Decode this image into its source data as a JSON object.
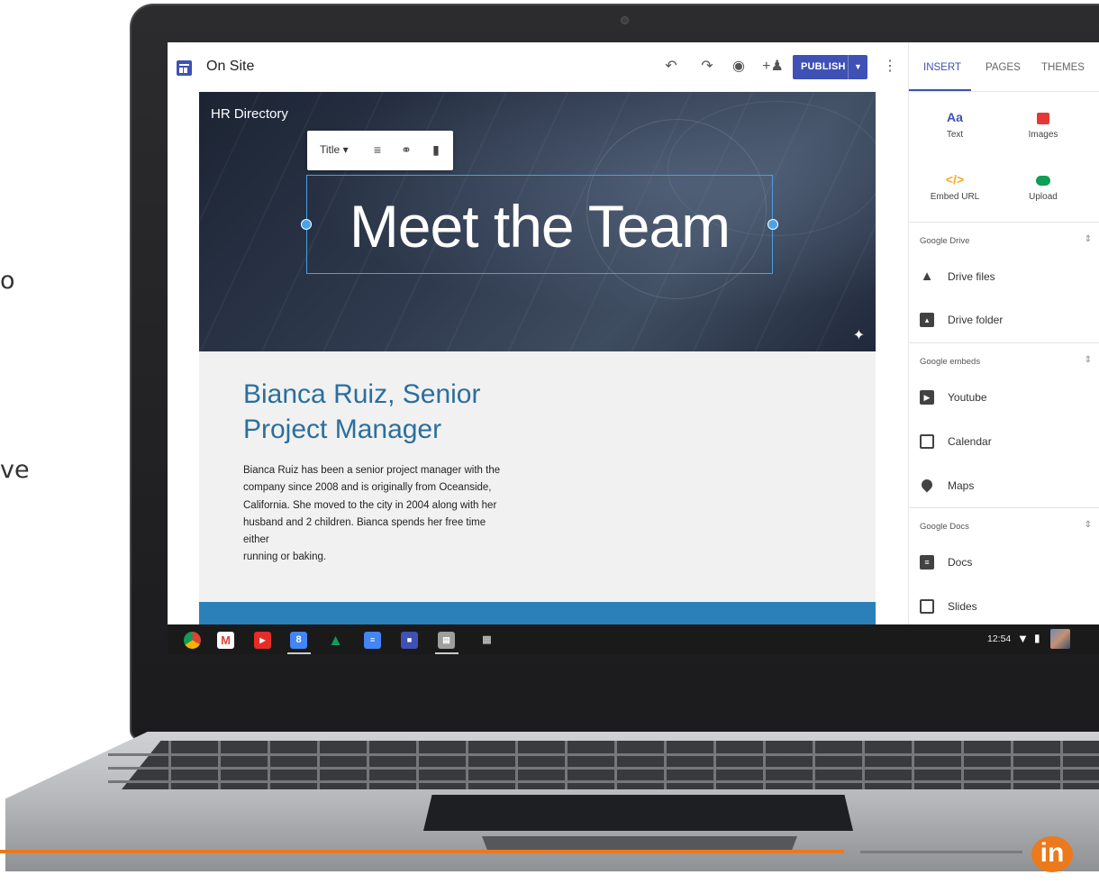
{
  "slide": {
    "left_text_top": "o",
    "left_text_bottom": "ve"
  },
  "app": {
    "title": "On Site",
    "publish_label": "PUBLISH"
  },
  "hero": {
    "page_name": "HR Directory",
    "title": "Meet the Team",
    "toolbar_style_label": "Title"
  },
  "content": {
    "name_line1": "Bianca Ruiz, Senior",
    "name_line2": "Project Manager",
    "bio": [
      "Bianca Ruiz has been a senior project manager with the",
      "company since 2008 and is originally from Oceanside,",
      "California.  She moved to the city in 2004 along with her",
      "husband and 2 children.  Bianca spends her free time either",
      "running or baking."
    ]
  },
  "panel": {
    "tabs": [
      "INSERT",
      "PAGES",
      "THEMES"
    ],
    "tiles": [
      {
        "icon_text": "Aa",
        "label": "Text"
      },
      {
        "icon_text": "",
        "label": "Images"
      },
      {
        "icon_text": "</>",
        "label": "Embed URL"
      },
      {
        "icon_text": "",
        "label": "Upload"
      }
    ],
    "sections": [
      {
        "header": "Google Drive",
        "items": [
          "Drive files",
          "Drive folder"
        ]
      },
      {
        "header": "Google embeds",
        "items": [
          "Youtube",
          "Calendar",
          "Maps"
        ]
      },
      {
        "header": "Google Docs",
        "items": [
          "Docs",
          "Slides"
        ]
      }
    ]
  },
  "shelf": {
    "time": "12:54"
  },
  "brand": {
    "logo_text": "in"
  },
  "colors": {
    "accent": "#3f51b5",
    "heading_blue": "#2b6f9c",
    "band_blue": "#2b80b9",
    "brand_orange": "#ea7a1c"
  }
}
